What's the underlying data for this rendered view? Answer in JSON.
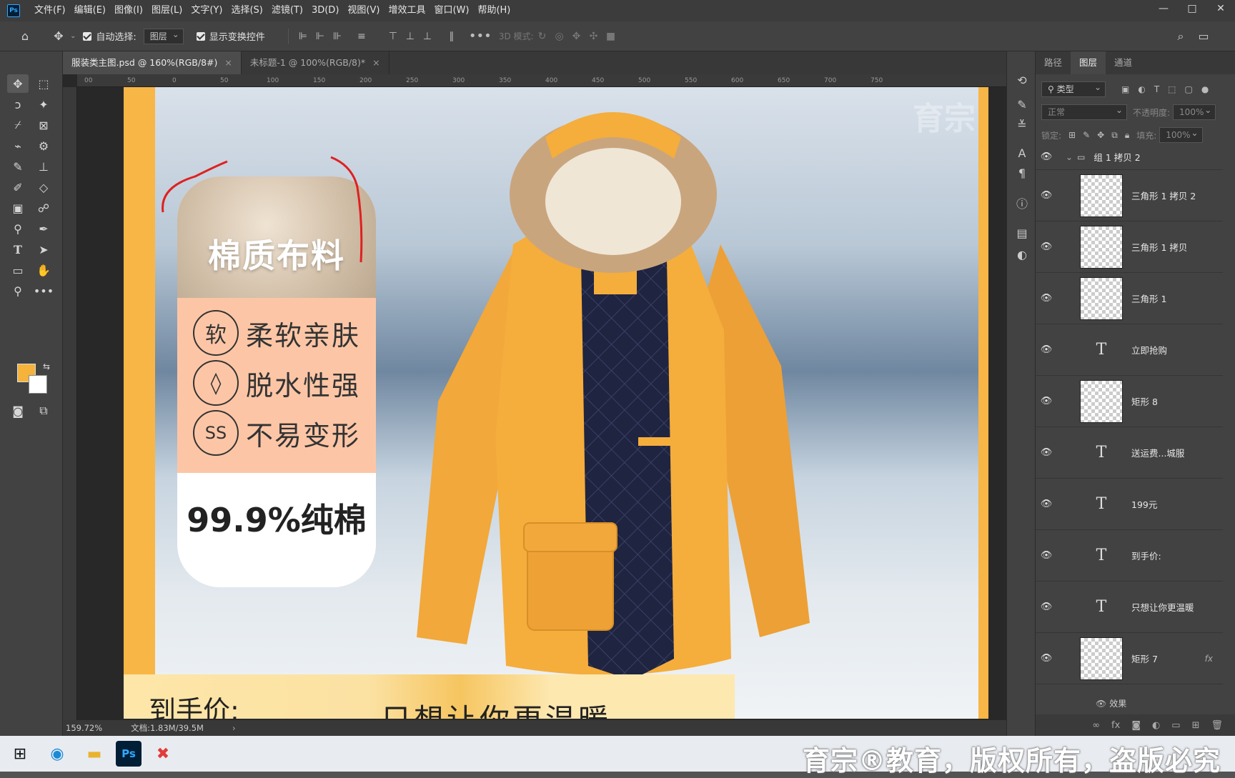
{
  "menubar": {
    "logo": "Ps",
    "items": [
      "文件(F)",
      "编辑(E)",
      "图像(I)",
      "图层(L)",
      "文字(Y)",
      "选择(S)",
      "滤镜(T)",
      "3D(D)",
      "视图(V)",
      "增效工具",
      "窗口(W)",
      "帮助(H)"
    ],
    "controls": [
      "—",
      "□",
      "✕"
    ]
  },
  "optbar": {
    "auto_select": "自动选择:",
    "auto_select_target": "图层",
    "show_transform": "显示变换控件",
    "mode_3d": "3D 模式:"
  },
  "tabs": [
    {
      "label": "服装类主图.psd @ 160%(RGB/8#)"
    },
    {
      "label": "未标题-1 @ 100%(RGB/8)*"
    }
  ],
  "ruler_ticks": [
    "00",
    "50",
    "0",
    "50",
    "100",
    "150",
    "200",
    "250",
    "300",
    "350",
    "400",
    "450",
    "500",
    "550",
    "600",
    "650",
    "700",
    "750"
  ],
  "canvas": {
    "card_title": "棉质布料",
    "features": [
      {
        "badge": "软",
        "text": "柔软亲肤"
      },
      {
        "badge": "◊",
        "text": "脱水性强"
      },
      {
        "badge": "SS",
        "text": "不易变形"
      }
    ],
    "percent": "99.9%纯棉",
    "price_label": "到手价:",
    "slogan": "只想让你更温暖",
    "watermark": "育宗"
  },
  "layers_panel": {
    "tabs": [
      "路径",
      "图层",
      "通道"
    ],
    "filter": "类型",
    "blend_mode": "正常",
    "opacity_label": "不透明度:",
    "opacity": "100%",
    "lock_label": "锁定:",
    "fill_label": "填充:",
    "fill": "100%",
    "group": "组 1 拷贝 2",
    "layers": [
      {
        "name": "三角形 1 拷贝 2",
        "type": "shape"
      },
      {
        "name": "三角形 1 拷贝",
        "type": "shape"
      },
      {
        "name": "三角形 1",
        "type": "shape"
      },
      {
        "name": "立即抢购",
        "type": "text"
      },
      {
        "name": "矩形 8",
        "type": "shape"
      },
      {
        "name": "送运费...城服",
        "type": "text"
      },
      {
        "name": "199元",
        "type": "text"
      },
      {
        "name": "到手价:",
        "type": "text"
      },
      {
        "name": "只想让你更温暖",
        "type": "text"
      },
      {
        "name": "矩形 7",
        "type": "shape"
      }
    ],
    "effects": "效果"
  },
  "status": {
    "zoom": "159.72%",
    "doc": "文档:1.83M/39.5M"
  },
  "taskbar": {
    "copyright": "育宗®教育，版权所有，盗版必究"
  }
}
